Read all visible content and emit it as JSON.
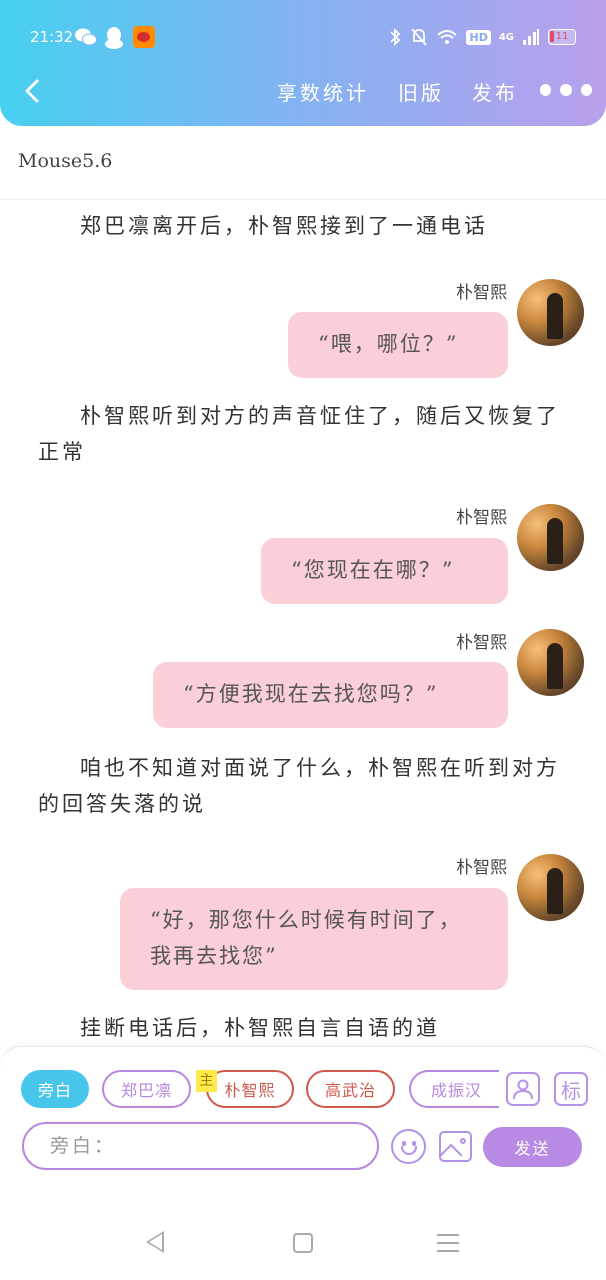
{
  "status_bar": {
    "time": "21:32",
    "network": "4G",
    "hd": "HD",
    "battery": "11"
  },
  "header": {
    "back_icon": "chevron-left-icon",
    "actions": [
      "享数统计",
      "旧版",
      "发布"
    ],
    "more_icon": "more-dots-icon"
  },
  "author": "Mouse5.6",
  "content": {
    "narration_1": "郑巴凛离开后，朴智熙接到了一通电话",
    "msg_1": {
      "speaker": "朴智熙",
      "text": "“喂，哪位？”"
    },
    "narration_2": "朴智熙听到对方的声音怔住了，随后又恢复了正常",
    "msg_2": {
      "speaker": "朴智熙",
      "text": "“您现在在哪？”"
    },
    "msg_3": {
      "speaker": "朴智熙",
      "text": "“方便我现在去找您吗？”"
    },
    "narration_3": "咱也不知道对面说了什么，朴智熙在听到对方的回答失落的说",
    "msg_4": {
      "speaker": "朴智熙",
      "text": "“好，那您什么时候有时间了，我再去找您”"
    },
    "narration_4": "挂断电话后，朴智熙自言自语的道"
  },
  "roles": [
    "旁白",
    "郑巴凛",
    "朴智熙",
    "高武治",
    "成振汉"
  ],
  "main_tag": "主",
  "tools": {
    "tag_label": "标",
    "person_icon": "person-icon"
  },
  "input": {
    "placeholder": "旁白："
  },
  "send_label": "发送",
  "colors": {
    "header_start": "#47d0f0",
    "header_end": "#b99fec",
    "bubble": "#fbcfd8",
    "accent": "#b787df",
    "narrator": "#47c6ec",
    "role_red": "#d0584a"
  }
}
